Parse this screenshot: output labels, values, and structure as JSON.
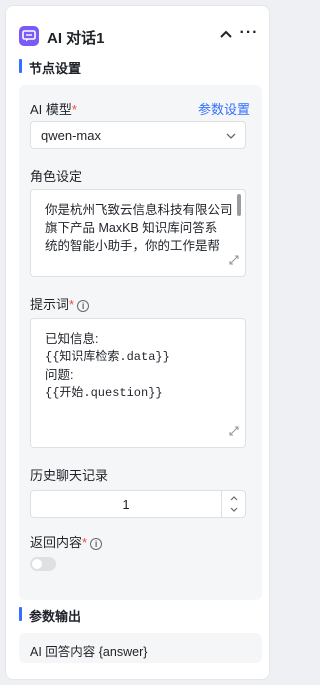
{
  "header": {
    "title": "AI 对话1"
  },
  "sections": {
    "node_settings": "节点设置",
    "output": "参数输出"
  },
  "model": {
    "label": "AI 模型",
    "required": "*",
    "settings_link": "参数设置",
    "value": "qwen-max"
  },
  "role": {
    "label": "角色设定",
    "lines": [
      "你是杭州飞致云信息科技有限公司",
      "旗下产品 MaxKB 知识库问答系",
      "统的智能小助手，你的工作是帮"
    ]
  },
  "prompt": {
    "label": "提示词",
    "required": "*",
    "lines": [
      "已知信息:",
      "{{知识库检索.data}}",
      "问题:",
      "{{开始.question}}"
    ]
  },
  "history": {
    "label": "历史聊天记录",
    "value": "1"
  },
  "return_content": {
    "label": "返回内容",
    "required": "*",
    "enabled": false
  },
  "output": {
    "item": "AI 回答内容 {answer}"
  },
  "colors": {
    "accent": "#3370ff",
    "icon_bg": "#7a5af8",
    "required": "#f54a45"
  },
  "icons": [
    "chat-bubble-icon",
    "chevron-up-icon",
    "more-icon",
    "chevron-down-icon",
    "info-icon",
    "resize-icon"
  ]
}
